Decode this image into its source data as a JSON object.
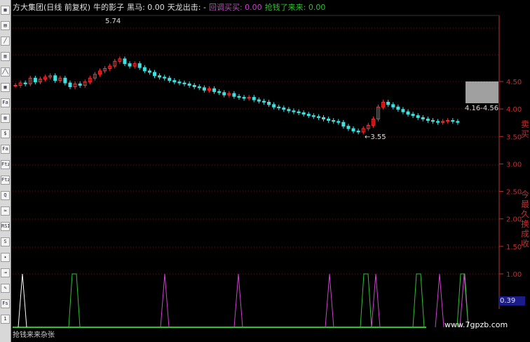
{
  "header": {
    "stock": "方大集团(日线 前复权)",
    "indicator": "牛的影子",
    "black_horse": "黑马: 0.00",
    "tianlong": "天龙出击: -",
    "pullback": "回调买买: 0.00",
    "grab": "抢钱了来来: 0.00"
  },
  "price_labels": [
    "4.50",
    "4.00",
    "3.50",
    "3.00",
    "2.50",
    "2.00",
    "1.50",
    "1.00"
  ],
  "indicator_label": "0.39",
  "range_label": "4.16-4.56",
  "peak_label": "5.74",
  "low_label": "←3.55",
  "footer_label": "抢钱来来杂张",
  "watermark": "www.7gpzb.com",
  "right_title_top": "卖买",
  "right_title_bottom": "今最久换成收",
  "toolbar_icons": [
    "▦",
    "▤",
    "╱",
    "▥",
    "╱╲",
    "▦",
    "Fa",
    "▥",
    "$",
    "Fa",
    "Ftz",
    "Ftz",
    "Q",
    "≈",
    "RSI",
    "S",
    "✦",
    "⇥",
    "✎",
    "Fs",
    "1"
  ],
  "colors": {
    "up": "#ff3030",
    "down": "#40e0e0",
    "axis": "#c03030",
    "magenta": "#d040d0",
    "green": "#30c030",
    "white": "#ffffff"
  },
  "chart_data": {
    "type": "candlestick",
    "y_range": [
      1.0,
      4.75
    ],
    "peak": 5.74,
    "low": 3.55,
    "series": [
      {
        "name": "price",
        "close": [
          4.55,
          4.6,
          4.58,
          4.7,
          4.62,
          4.68,
          4.72,
          4.75,
          4.65,
          4.7,
          4.6,
          4.52,
          4.58,
          4.55,
          4.62,
          4.7,
          4.78,
          4.85,
          4.9,
          4.95,
          5.05,
          5.1,
          5.0,
          4.95,
          5.0,
          4.92,
          4.85,
          4.82,
          4.75,
          4.72,
          4.7,
          4.65,
          4.62,
          4.6,
          4.58,
          4.55,
          4.52,
          4.5,
          4.45,
          4.48,
          4.42,
          4.4,
          4.35,
          4.38,
          4.32,
          4.3,
          4.28,
          4.3,
          4.25,
          4.22,
          4.2,
          4.15,
          4.1,
          4.08,
          4.05,
          4.02,
          4.0,
          3.98,
          3.95,
          3.92,
          3.9,
          3.88,
          3.85,
          3.82,
          3.8,
          3.78,
          3.7,
          3.65,
          3.6,
          3.58,
          3.65,
          3.72,
          3.85,
          4.1,
          4.2,
          4.15,
          4.1,
          4.05,
          4.0,
          3.95,
          3.92,
          3.88,
          3.85,
          3.82,
          3.8,
          3.78,
          3.8,
          3.82,
          3.8,
          3.78
        ]
      }
    ],
    "signals_magenta_x": [
      235,
      340,
      470,
      536,
      627,
      662
    ],
    "signals_green_x": [
      106,
      522,
      597,
      660
    ]
  }
}
